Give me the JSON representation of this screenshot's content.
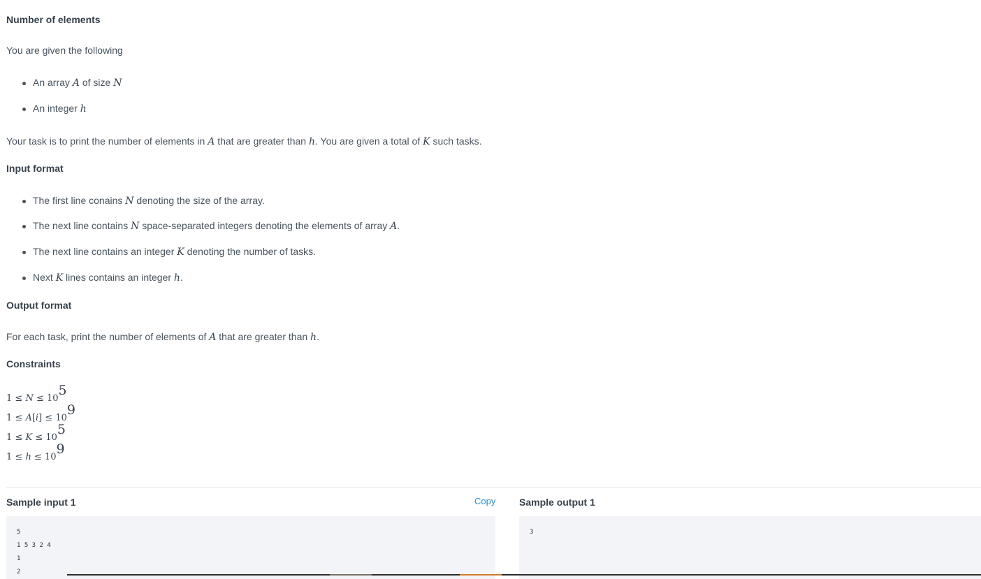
{
  "problem": {
    "title": "Number of elements",
    "intro": "You are given the following",
    "given_items": [
      {
        "text_before": "An array ",
        "var1": "A",
        "text_mid": " of size ",
        "var2": "N"
      },
      {
        "text_before": "An integer ",
        "var1": "h"
      }
    ],
    "task": {
      "t1": "Your task is to print the number of elements in ",
      "v1": "A",
      "t2": " that are greater than ",
      "v2": "h",
      "t3": ". You are given a total of ",
      "v3": "K",
      "t4": " such tasks."
    },
    "input_format_heading": "Input format",
    "input_items": [
      {
        "a": "The first line conains ",
        "v": "N",
        "b": " denoting the size of the array."
      },
      {
        "a": "The next line contains ",
        "v": "N",
        "b": " space-separated integers denoting the elements of array ",
        "v2": "A",
        "c": "."
      },
      {
        "a": "The next line  contains an integer ",
        "v": "K",
        "b": " denoting the number of tasks."
      },
      {
        "a": "Next ",
        "v": "K",
        "b": " lines contains an integer ",
        "v2": "h",
        "c": "."
      }
    ],
    "output_format_heading": "Output format",
    "output_text": {
      "a": "For each task, print the number of elements of ",
      "v1": "A",
      "b": " that are greater than ",
      "v2": "h",
      "c": "."
    },
    "constraints_heading": "Constraints",
    "constraints": [
      {
        "pre": "1 ≤ ",
        "var": "N",
        "post": " ≤ 10",
        "exp": "5"
      },
      {
        "pre": "1 ≤ ",
        "var": "A",
        "mid": "[",
        "idx": "i",
        "end": "]",
        "post": " ≤ 10",
        "exp": "9"
      },
      {
        "pre": "1 ≤ ",
        "var": "K",
        "post": " ≤ 10",
        "exp": "5"
      },
      {
        "pre": "1 ≤ ",
        "var": "h",
        "post": " ≤ 10",
        "exp": "9"
      }
    ]
  },
  "samples": {
    "input_title": "Sample input 1",
    "copy_label": "Copy",
    "input_lines": [
      "5",
      "1 5 3 2 4",
      "1",
      "2"
    ],
    "output_title": "Sample output 1",
    "output_lines": [
      "3"
    ]
  }
}
